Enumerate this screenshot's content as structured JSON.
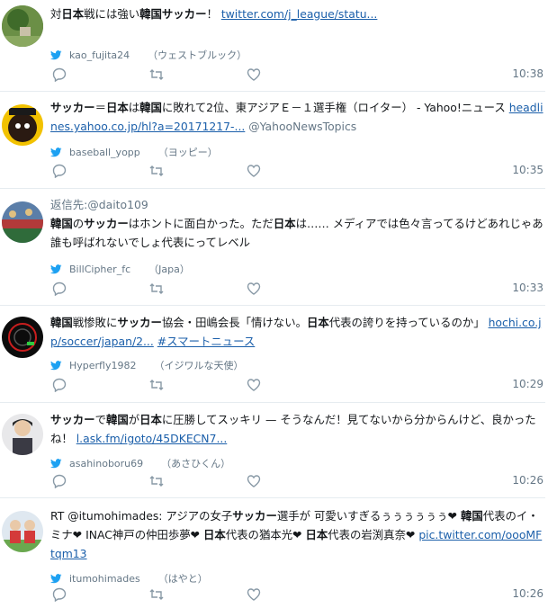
{
  "colors": {
    "link": "#1b5faa",
    "muted": "#657786",
    "bird": "#1da1f2",
    "divider": "#e6ecf0"
  },
  "icons": {
    "reply": "reply-icon",
    "retweet": "retweet-icon",
    "like": "heart-icon",
    "source": "twitter-bird-icon"
  },
  "tweets": [
    {
      "reply_to": "",
      "text": "対日本戦には強い韓国サッカー！",
      "link": "twitter.com/j_league/statu...",
      "screen_name": "kao_fujita24",
      "display_name": "（ウェストブルック）",
      "time": "10:38"
    },
    {
      "reply_to": "",
      "text": "サッカー＝日本は韓国に敗れて2位、東アジアＥ－１選手権（ロイター） - Yahoo!ニュース",
      "link": "headlines.yahoo.co.jp/hl?a=20171217-...",
      "mention": "@YahooNewsTopics",
      "screen_name": "baseball_yopp",
      "display_name": "（ヨッピー）",
      "time": "10:35"
    },
    {
      "reply_to": "返信先:@daito109",
      "text": "韓国のサッカーはホントに面白かった。ただ日本は…… メディアでは色々言ってるけどあれじゃあ誰も呼ばれないでしょ代表にってレベル",
      "screen_name": "BillCipher_fc",
      "display_name": "（Japa）",
      "time": "10:33"
    },
    {
      "reply_to": "",
      "text": "韓国戦惨敗にサッカー協会・田嶋会長「情けない。日本代表の誇りを持っているのか」",
      "link": "hochi.co.jp/soccer/japan/2...",
      "hashtag": "#スマートニュース",
      "screen_name": "Hyperfly1982",
      "display_name": "（イジワルな天使）",
      "time": "10:29"
    },
    {
      "reply_to": "",
      "text": "サッカーで韓国が日本に圧勝してスッキリ — そうなんだ！見てないから分からんけど、良かったね！",
      "link": "l.ask.fm/igoto/45DKECN7...",
      "screen_name": "asahinoboru69",
      "display_name": "（あさひくん）",
      "time": "10:26"
    },
    {
      "reply_to": "",
      "text": "RT @itumohimades: アジアの女子サッカー選手が 可愛いすぎるぅぅぅぅぅぅ❤ 韓国代表のイ・ミナ❤ INAC神戸の仲田歩夢❤ 日本代表の猶本光❤ 日本代表の岩渕真奈❤",
      "link": "pic.twitter.com/oooMFtqm13",
      "screen_name": "itumohimades",
      "display_name": "（はやと）",
      "time": "10:26"
    }
  ]
}
